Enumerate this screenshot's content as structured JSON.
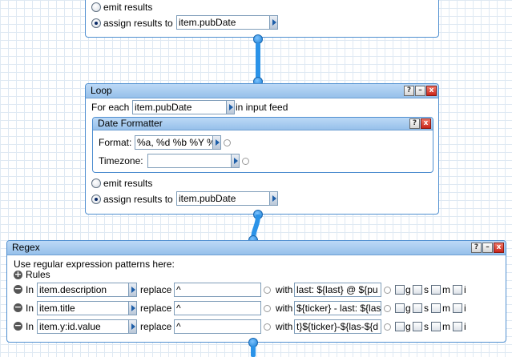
{
  "top_module": {
    "emit_label": "emit results",
    "assign_label": "assign results to",
    "assign_value": "item.pubDate"
  },
  "loop": {
    "title": "Loop",
    "for_each_label": "For each",
    "for_each_value": "item.pubDate",
    "in_feed_label": "in input feed",
    "emit_label": "emit results",
    "assign_label": "assign results to",
    "assign_value": "item.pubDate",
    "date_formatter": {
      "title": "Date Formatter",
      "format_label": "Format:",
      "format_value": "%a, %d %b %Y %",
      "timezone_label": "Timezone:",
      "timezone_value": ""
    }
  },
  "regex": {
    "title": "Regex",
    "intro": "Use regular expression patterns here:",
    "rules_label": "Rules",
    "in_label": "In",
    "replace_label": "replace",
    "with_label": "with",
    "flag_g": "g",
    "flag_s": "s",
    "flag_m": "m",
    "flag_i": "i",
    "rules": [
      {
        "field": "item.description",
        "pattern": "^",
        "replacement": "last: ${last}   @ ${pu"
      },
      {
        "field": "item.title",
        "pattern": "^",
        "replacement": "${ticker} - last: ${las"
      },
      {
        "field": "item.y:id.value",
        "pattern": "^",
        "replacement": "t}${ticker}-${las-${d"
      }
    ]
  },
  "window_buttons": {
    "help": "?",
    "minimize": "–",
    "close": "x"
  },
  "colors": {
    "accent": "#4f8fd0",
    "titlebar": "#a8cdf2",
    "pipe": "#1a7fd4"
  }
}
